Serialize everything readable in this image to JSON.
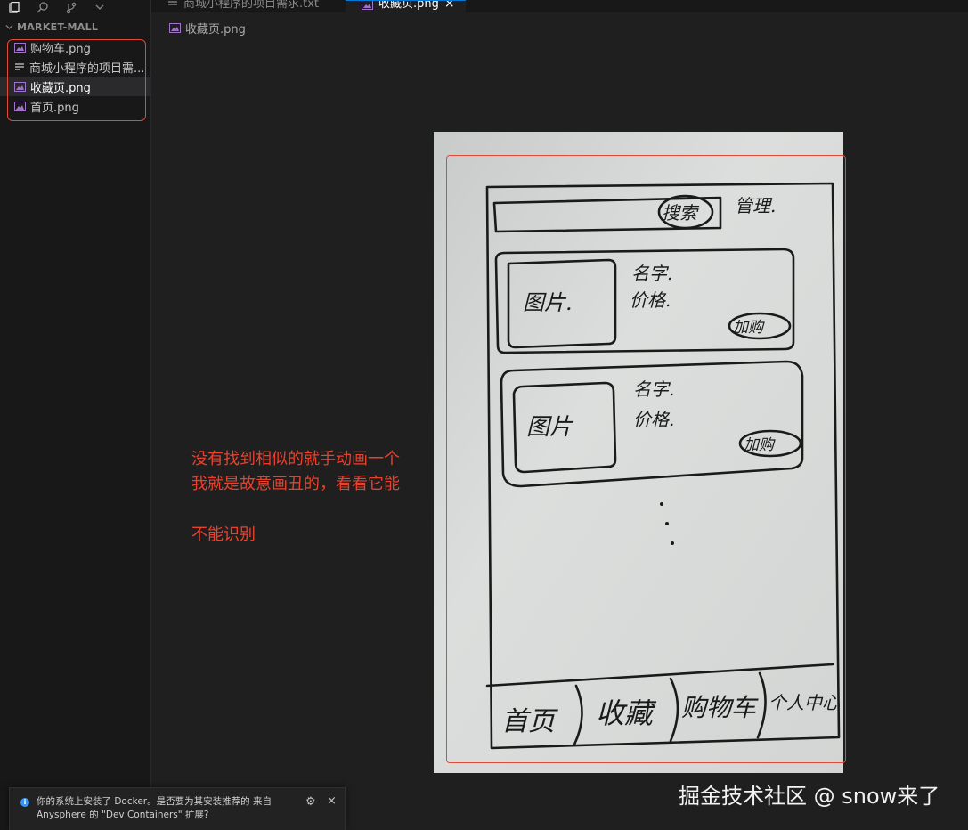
{
  "explorer": {
    "title": "MARKET-MALL",
    "files": [
      {
        "name": "购物车.png",
        "icon": "image-file-icon"
      },
      {
        "name": "商城小程序的项目需...",
        "icon": "text-file-icon"
      },
      {
        "name": "收藏页.png",
        "icon": "image-file-icon",
        "selected": true
      },
      {
        "name": "首页.png",
        "icon": "image-file-icon"
      }
    ]
  },
  "tabs": [
    {
      "label": "商城小程序的项目需求.txt",
      "icon": "text-file-icon",
      "active": false
    },
    {
      "label": "收藏页.png",
      "icon": "image-file-icon",
      "active": true,
      "close": "×"
    }
  ],
  "breadcrumb": {
    "file": "收藏页.png"
  },
  "annotation": {
    "line1": "没有找到相似的就手动画一个",
    "line2": "我就是故意画丑的，看看它能",
    "line3": "不能识别",
    "color": "#e8412d"
  },
  "sketch": {
    "search_button": "搜索",
    "manage": "管理.",
    "items": [
      {
        "image": "图片.",
        "name": "名字.",
        "price": "价格.",
        "cart": "加购"
      },
      {
        "image": "图片",
        "name": "名字.",
        "price": "价格.",
        "cart": "加购"
      }
    ],
    "nav": [
      "首页",
      "收藏",
      "购物车",
      "个人中心"
    ]
  },
  "notification": {
    "text": "你的系统上安装了 Docker。是否要为其安装推荐的 来自 Anysphere 的 \"Dev Containers\" 扩展?",
    "gear": "⚙",
    "close": "×"
  },
  "watermark": "掘金技术社区 @ snow来了",
  "colors": {
    "editor_bg": "#1f1f1f",
    "sidebar_bg": "#181818",
    "accent": "#0078d4",
    "annotation_red": "#e04a3a"
  }
}
